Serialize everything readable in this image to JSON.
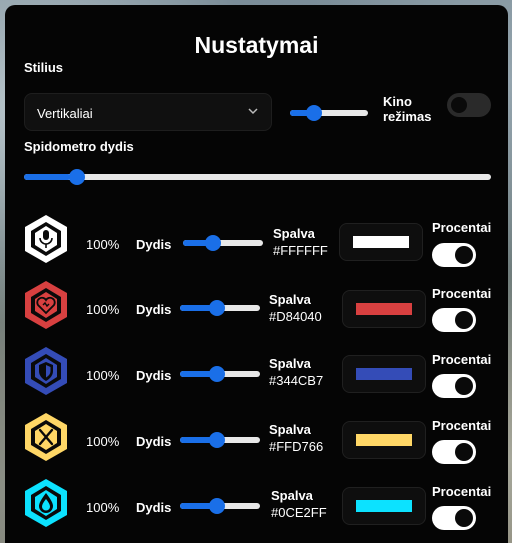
{
  "title": "Nustatymai",
  "style_label": "Stilius",
  "style_select_value": "Vertikaliai",
  "kino_label": "Kino režimas",
  "kino_on": false,
  "top_slider_level": 0.25,
  "speedometer_label": "Spidometro dydis",
  "speedometer_level": 0.1,
  "rows": [
    {
      "icon": "microphone-icon",
      "percent": "100%",
      "size_label": "Dydis",
      "size_level": 0.35,
      "color_label": "Spalva",
      "hex": "#FFFFFF",
      "swatch": "#FFFFFF",
      "percent_label": "Procentai",
      "toggle_on": true
    },
    {
      "icon": "heart-icon",
      "percent": "100%",
      "size_label": "Dydis",
      "size_level": 0.45,
      "color_label": "Spalva",
      "hex": "#D84040",
      "swatch": "#D84040",
      "percent_label": "Procentai",
      "toggle_on": true
    },
    {
      "icon": "shield-icon",
      "percent": "100%",
      "size_label": "Dydis",
      "size_level": 0.45,
      "color_label": "Spalva",
      "hex": "#344CB7",
      "swatch": "#344CB7",
      "percent_label": "Procentai",
      "toggle_on": true
    },
    {
      "icon": "fork-knife-icon",
      "percent": "100%",
      "size_label": "Dydis",
      "size_level": 0.45,
      "color_label": "Spalva",
      "hex": "#FFD766",
      "swatch": "#FFD766",
      "percent_label": "Procentai",
      "toggle_on": true
    },
    {
      "icon": "water-drop-icon",
      "percent": "100%",
      "size_label": "Dydis",
      "size_level": 0.45,
      "color_label": "Spalva",
      "hex": "#0CE2FF",
      "swatch": "#0CE2FF",
      "percent_label": "Procentai",
      "toggle_on": true
    }
  ]
}
